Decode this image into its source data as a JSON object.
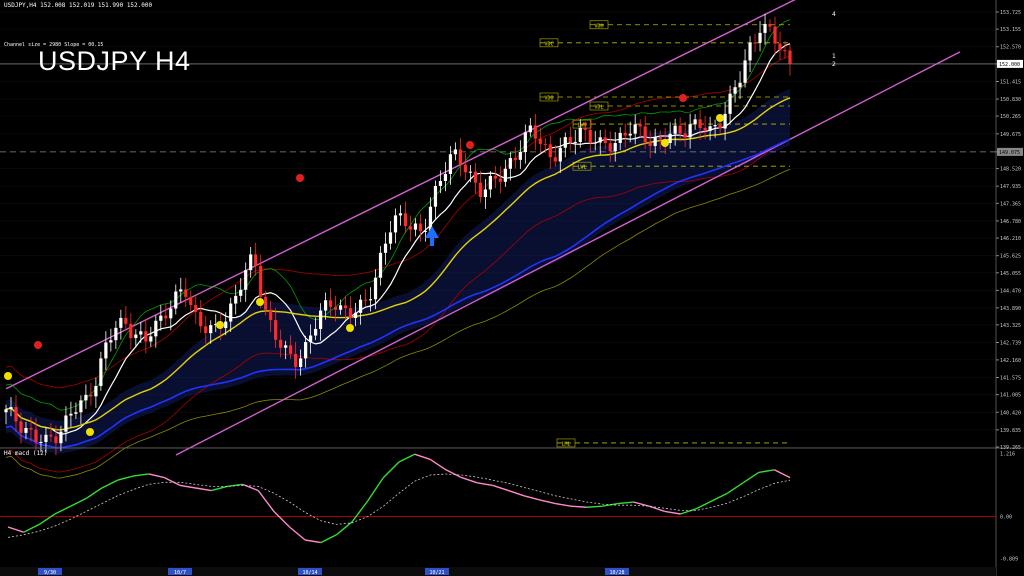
{
  "header": {
    "symbol_line": "USDJPY,H4  152.008 152.019 151.990 152.000",
    "channel_info": "Channel size = 2980 Slope = 00.15",
    "big_title": "USDJPY H4",
    "macd_label": "H4  macd (12)"
  },
  "colors": {
    "background": "#000000",
    "candle_up": "#ffffff",
    "candle_down": "#ff2a2a",
    "channel": "#d060d0",
    "ma_yellow": "#e6d200",
    "ma_blue": "#2233ff",
    "ma_white": "#ffffff",
    "cloud_green": "#00a000",
    "macd_up": "#33dd33",
    "macd_down": "#ff88cc",
    "signal": "#cccccc",
    "zero_line": "#c00000",
    "price_box": "#ffffff",
    "date_box": "#3050c8"
  },
  "chart_data": {
    "type": "candlestick",
    "symbol": "USDJPY",
    "timeframe": "H4",
    "price_range": [
      139.265,
      153.725
    ],
    "y_ticks": [
      153.725,
      153.155,
      152.57,
      152.0,
      151.415,
      150.83,
      150.265,
      149.675,
      149.075,
      148.52,
      147.935,
      147.365,
      146.78,
      146.21,
      145.625,
      145.055,
      144.47,
      143.89,
      143.325,
      142.739,
      142.16,
      141.575,
      141.005,
      140.42,
      139.835,
      139.265
    ],
    "current_price": 152.0,
    "marked_level": 149.075,
    "x_dates": [
      "9/30",
      "10/7",
      "10/14",
      "10/21",
      "10/28"
    ],
    "ohlc_path": [
      140.4,
      140.2,
      139.9,
      139.5,
      139.4,
      139.7,
      140.1,
      140.5,
      140.8,
      141.5,
      142.5,
      143.2,
      143.5,
      143.0,
      142.7,
      143.3,
      143.8,
      144.1,
      144.5,
      143.7,
      143.3,
      143.0,
      143.5,
      144.2,
      145.0,
      145.5,
      144.0,
      143.1,
      142.4,
      142.1,
      142.5,
      143.2,
      143.8,
      144.2,
      143.8,
      143.6,
      144.0,
      144.7,
      145.8,
      146.7,
      147.0,
      146.6,
      146.2,
      147.5,
      148.5,
      149.0,
      148.6,
      148.2,
      147.8,
      148.0,
      148.3,
      148.9,
      149.3,
      149.8,
      149.4,
      148.9,
      149.1,
      149.5,
      149.9,
      149.5,
      149.2,
      149.4,
      149.6,
      149.8,
      149.7,
      149.5,
      149.4,
      149.6,
      149.8,
      150.0,
      149.9,
      149.7,
      150.2,
      150.8,
      151.5,
      152.6,
      153.3,
      153.0,
      152.5,
      152.1
    ],
    "level_tags": [
      "VDH",
      "VDC",
      "VDO",
      "VDL",
      "LWH",
      "LWL",
      "LML"
    ],
    "channel_tags": [
      "4",
      "1",
      "2"
    ],
    "macd": {
      "label": "H4  macd (12)",
      "y_ticks": [
        1.216,
        0.0,
        -0.809
      ],
      "range": [
        -0.95,
        1.3
      ],
      "values": [
        -0.2,
        -0.3,
        -0.15,
        0.05,
        0.2,
        0.35,
        0.55,
        0.7,
        0.78,
        0.82,
        0.75,
        0.6,
        0.55,
        0.5,
        0.58,
        0.62,
        0.5,
        0.1,
        -0.2,
        -0.45,
        -0.5,
        -0.35,
        -0.1,
        0.3,
        0.75,
        1.05,
        1.2,
        1.1,
        0.9,
        0.75,
        0.65,
        0.6,
        0.5,
        0.4,
        0.32,
        0.25,
        0.2,
        0.18,
        0.2,
        0.25,
        0.28,
        0.2,
        0.1,
        0.05,
        0.15,
        0.3,
        0.45,
        0.65,
        0.85,
        0.9,
        0.75
      ],
      "signal": [
        -0.4,
        -0.35,
        -0.28,
        -0.18,
        -0.05,
        0.1,
        0.25,
        0.4,
        0.52,
        0.62,
        0.66,
        0.66,
        0.62,
        0.58,
        0.58,
        0.6,
        0.58,
        0.45,
        0.28,
        0.08,
        -0.08,
        -0.15,
        -0.12,
        0.0,
        0.2,
        0.45,
        0.68,
        0.8,
        0.82,
        0.8,
        0.76,
        0.7,
        0.64,
        0.56,
        0.48,
        0.4,
        0.34,
        0.28,
        0.24,
        0.22,
        0.22,
        0.2,
        0.16,
        0.12,
        0.12,
        0.18,
        0.26,
        0.38,
        0.52,
        0.64,
        0.7
      ]
    }
  }
}
